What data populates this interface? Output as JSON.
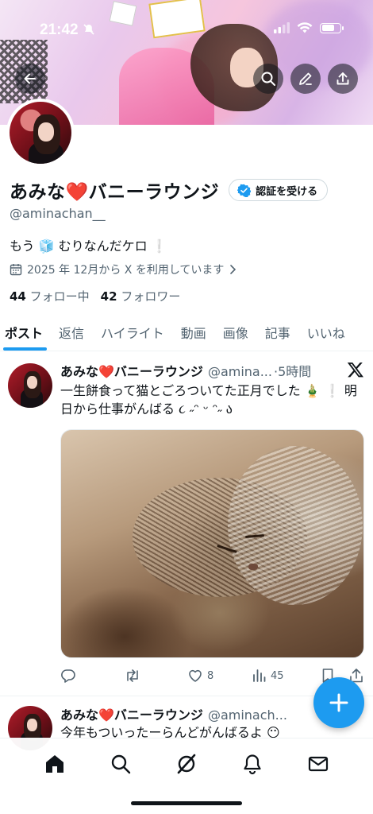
{
  "status_bar": {
    "time": "21:42"
  },
  "profile": {
    "display_name": "あみな❤️バニーラウンジ",
    "verify_label": "認証を受ける",
    "handle": "@aminachan__",
    "bio": "もう 🧊 むりなんだケロ ❕",
    "joined": "2025 年 12月から X を利用しています",
    "following_count": "44",
    "following_label": "フォロー中",
    "followers_count": "42",
    "followers_label": "フォロワー"
  },
  "tabs": [
    {
      "label": "ポスト",
      "active": true
    },
    {
      "label": "返信"
    },
    {
      "label": "ハイライト"
    },
    {
      "label": "動画"
    },
    {
      "label": "画像"
    },
    {
      "label": "記事"
    },
    {
      "label": "いいね"
    }
  ],
  "posts": [
    {
      "name": "あみな❤️バニーラウンジ",
      "handle": "@amina...",
      "time": "·5時間",
      "text": "一生餅食って猫とごろついてた正月でした 🎍 ❕ 明日から仕事がんばる ૮ ˶ᵔ ᵕ ᵔ˶ ა",
      "like_count": "8",
      "view_count": "45"
    },
    {
      "name": "あみな❤️バニーラウンジ",
      "handle": "@aminach...",
      "text": "今年もついったーらんどがんばるよ 😶"
    }
  ],
  "icons": {
    "back": "back-arrow-icon",
    "search": "search-icon",
    "edit": "edit-icon",
    "share": "share-icon",
    "verified": "verified-badge-icon",
    "calendar": "calendar-icon",
    "x_logo": "x-logo-icon",
    "reply": "reply-icon",
    "repost": "repost-icon",
    "like": "heart-icon",
    "views": "views-icon",
    "bookmark": "bookmark-icon",
    "compose": "plus-icon"
  },
  "colors": {
    "accent": "#1d9bf0",
    "text": "#0f1419",
    "muted": "#536471"
  }
}
